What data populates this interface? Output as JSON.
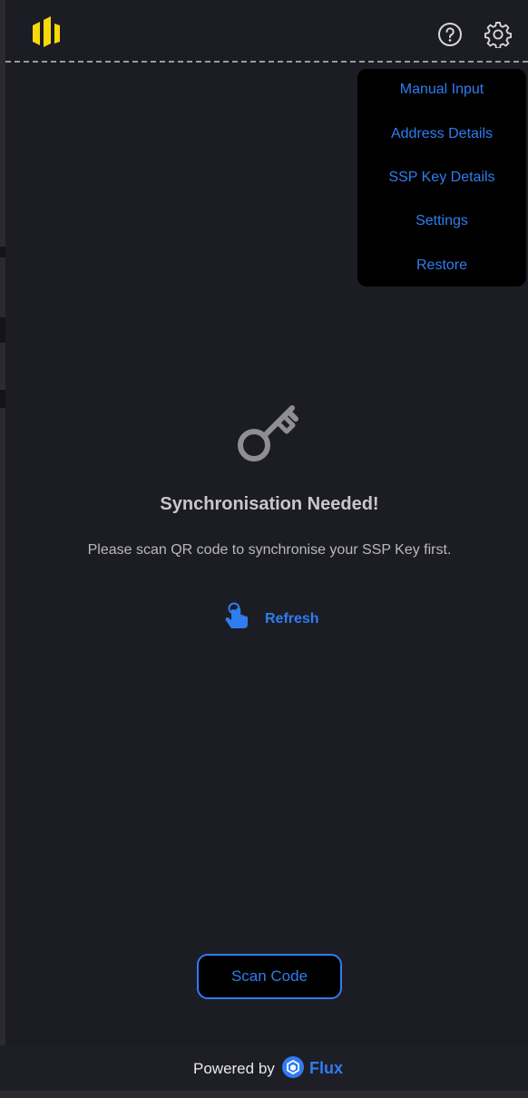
{
  "header": {
    "logo_icon": "flux-ssp-logo",
    "help_icon": "question-circle-icon",
    "settings_icon": "gear-icon"
  },
  "menu": {
    "items": [
      {
        "label": "Manual Input"
      },
      {
        "label": "Address Details"
      },
      {
        "label": "SSP Key Details"
      },
      {
        "label": "Settings"
      },
      {
        "label": "Restore"
      }
    ]
  },
  "main": {
    "icon": "key-icon",
    "title": "Synchronisation Needed!",
    "message": "Please scan QR code to synchronise your SSP Key first.",
    "refresh_label": "Refresh",
    "refresh_icon": "tap-hand-icon"
  },
  "scan": {
    "label": "Scan Code"
  },
  "footer": {
    "powered_by": "Powered by",
    "brand": "Flux",
    "brand_icon": "flux-icon"
  },
  "colors": {
    "background": "#1c1c24",
    "accent": "#2f7df0",
    "logo": "#f5d90a",
    "menu_bg": "#000000"
  }
}
